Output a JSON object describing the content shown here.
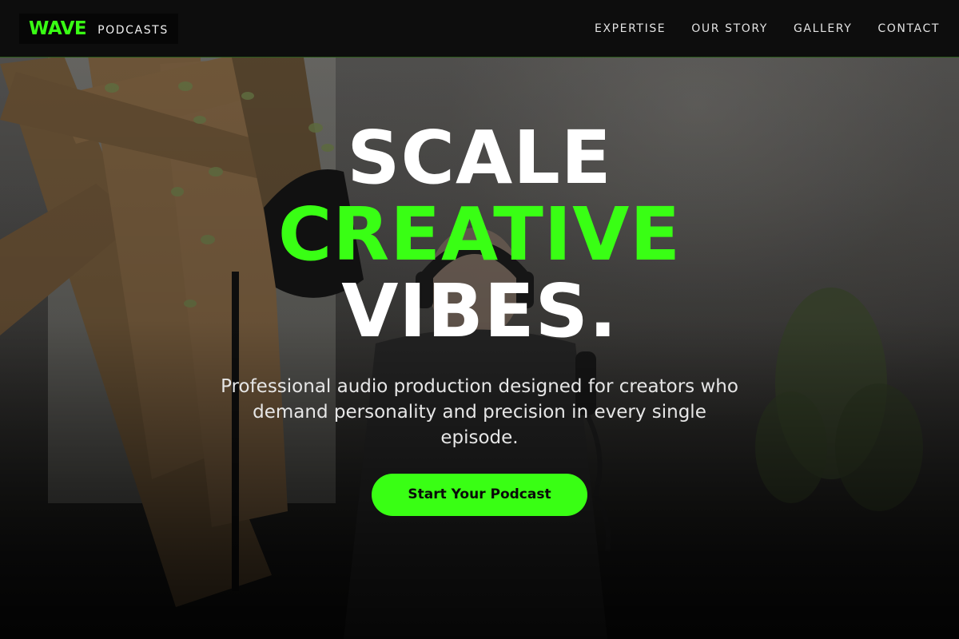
{
  "brand": {
    "name": "WAVE",
    "sub": "PODCASTS"
  },
  "nav": {
    "items": [
      {
        "label": "EXPERTISE"
      },
      {
        "label": "OUR STORY"
      },
      {
        "label": "GALLERY"
      },
      {
        "label": "CONTACT"
      }
    ]
  },
  "hero": {
    "headline_line1": "SCALE",
    "headline_line2": "CREATIVE",
    "headline_line3": "VIBES.",
    "subtitle": "Professional audio production designed for creators who demand personality and precision in every single episode.",
    "cta_label": "Start Your Podcast"
  },
  "colors": {
    "accent": "#39ff14",
    "navbar_bg": "#0d0d0d",
    "text_primary": "#ffffff"
  }
}
